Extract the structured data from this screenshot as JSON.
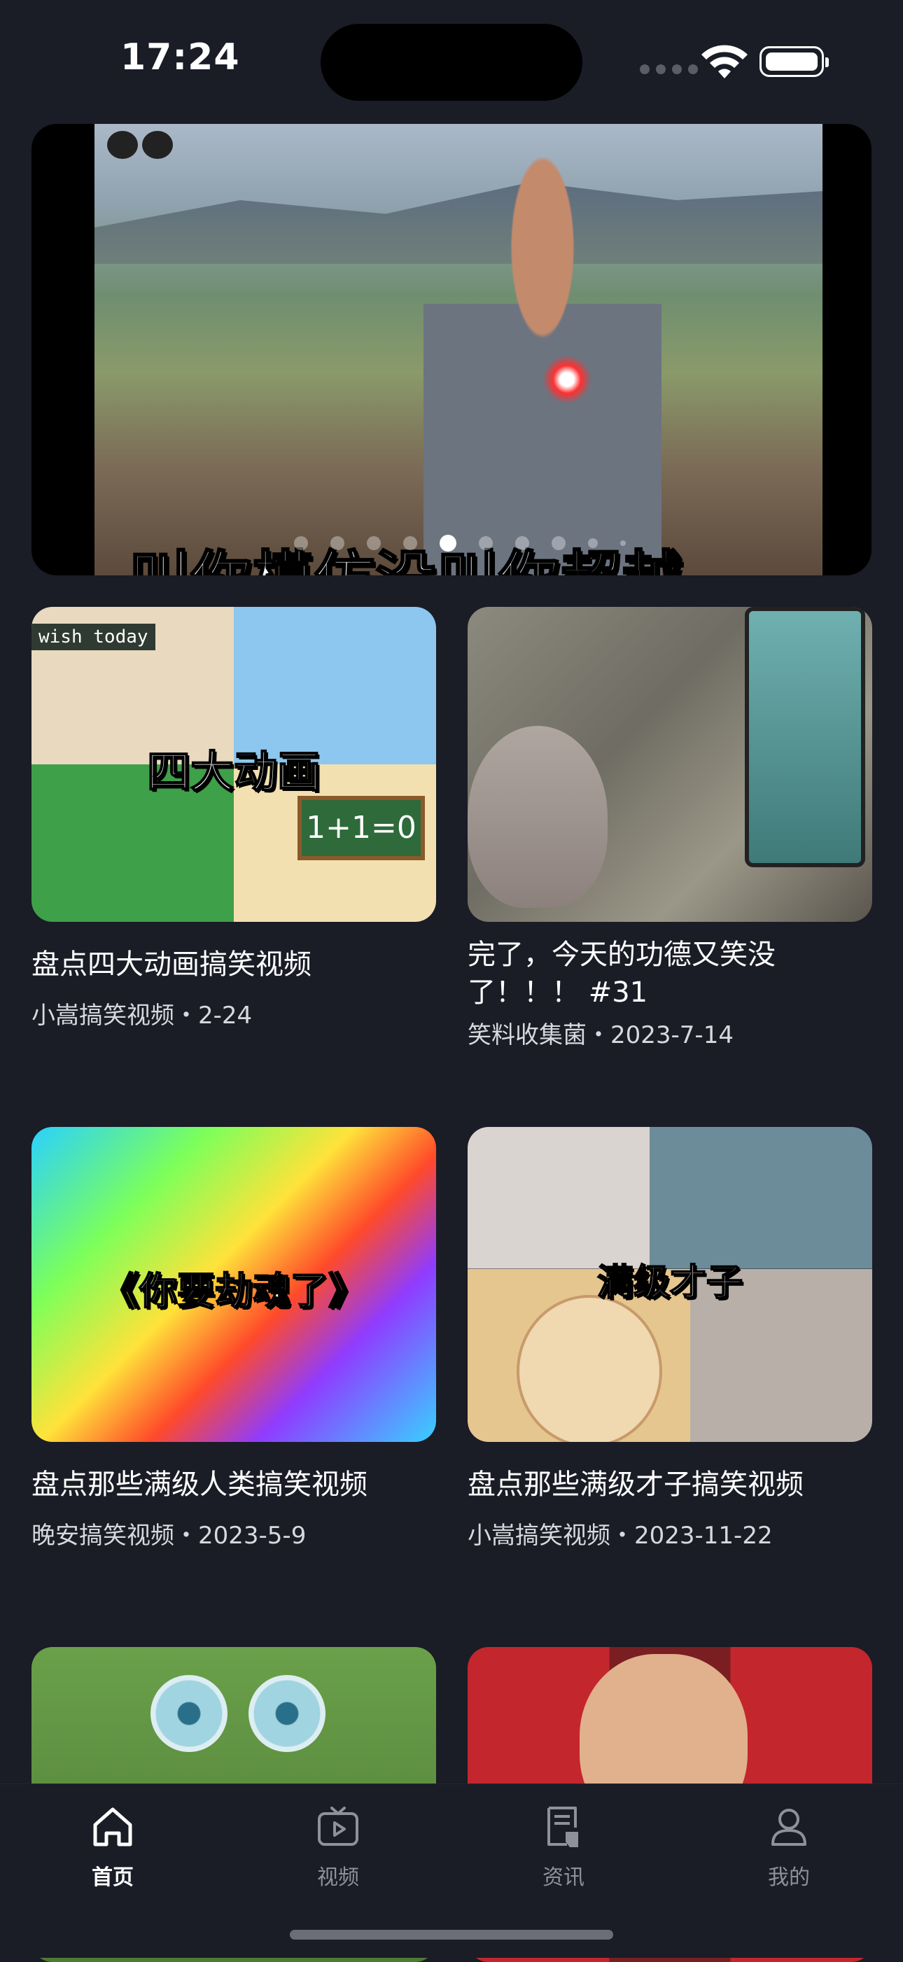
{
  "status_bar": {
    "time": "17:24"
  },
  "banner": {
    "caption": "叫你模仿没叫你超越",
    "page_count": 10,
    "active_page": 5
  },
  "feed": [
    {
      "thumb_text": "四大动画",
      "thumb_sub": "wish today",
      "board": "1+1=0",
      "title": "盘点四大动画搞笑视频",
      "meta": "小嵩搞笑视频・2-24"
    },
    {
      "thumb_text": "",
      "title": "完了，今天的功德又笑没了！！！ #31",
      "meta": "笑料收集菌・2023-7-14"
    },
    {
      "thumb_text": "《你要劫魂了》",
      "title": "盘点那些满级人类搞笑视频",
      "meta": "晚安搞笑视频・2023-5-9"
    },
    {
      "thumb_text": "满级才子",
      "title": "盘点那些满级才子搞笑视频",
      "meta": "小嵩搞笑视频・2023-11-22"
    },
    {
      "thumb_text": "",
      "title": "",
      "meta": ""
    },
    {
      "thumb_text": "",
      "title": "",
      "meta": ""
    }
  ],
  "tabbar": {
    "tabs": [
      {
        "label": "首页",
        "icon": "home-icon",
        "active": true
      },
      {
        "label": "视频",
        "icon": "tv-play-icon",
        "active": false
      },
      {
        "label": "资讯",
        "icon": "news-icon",
        "active": false
      },
      {
        "label": "我的",
        "icon": "person-icon",
        "active": false
      }
    ]
  },
  "colors": {
    "background": "#1a1c26",
    "active_tab": "#ffffff",
    "inactive_tab": "#8e909a"
  }
}
